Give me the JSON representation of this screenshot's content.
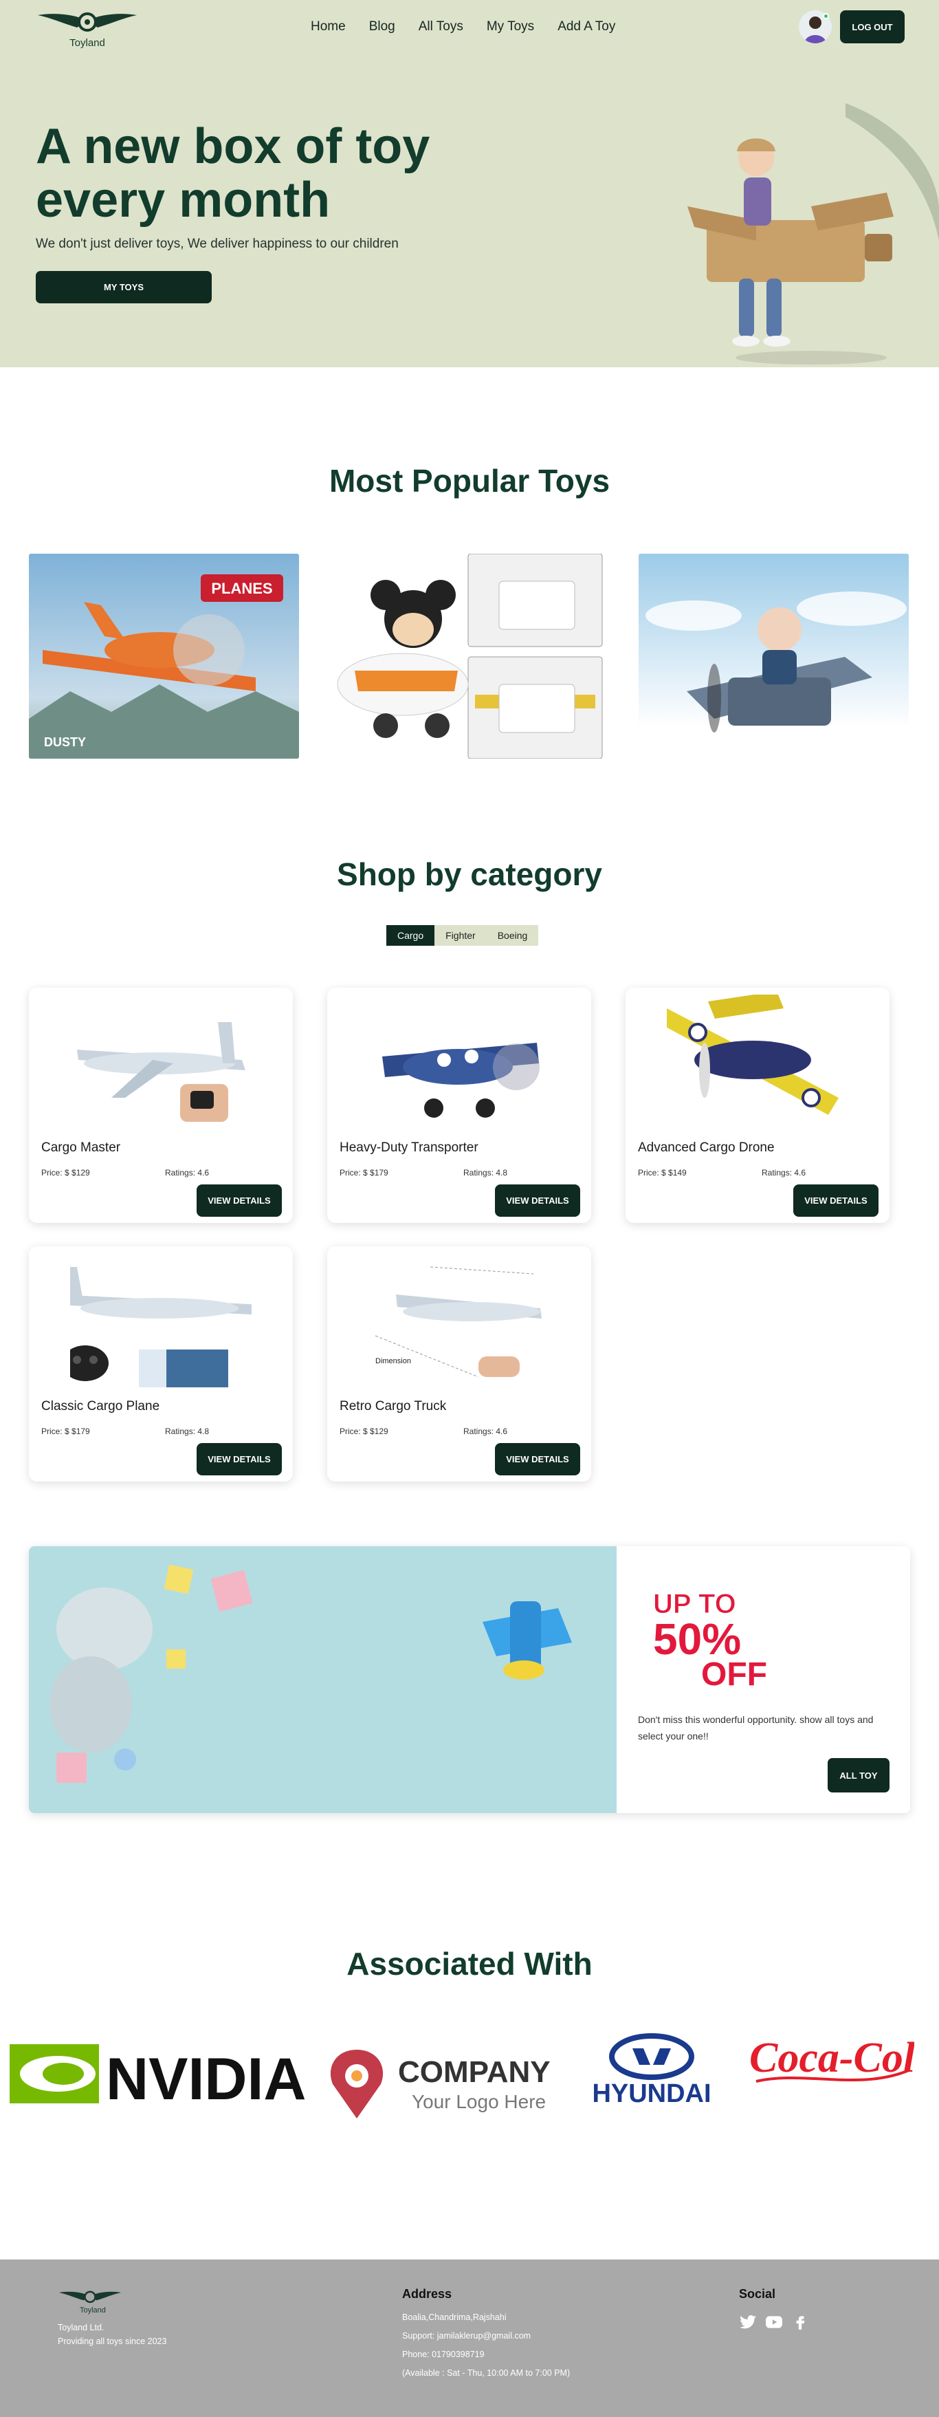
{
  "brand": {
    "name": "Toyland"
  },
  "nav": {
    "links": [
      "Home",
      "Blog",
      "All Toys",
      "My Toys",
      "Add A Toy"
    ],
    "logout": "LOG OUT"
  },
  "hero": {
    "title": "A new box of toy every month",
    "subtitle": "We don't just deliver toys, We deliver happiness to our children",
    "button": "MY TOYS"
  },
  "popular": {
    "title": "Most Popular Toys",
    "items": [
      {
        "caption": "DUSTY",
        "logo": "PLANES"
      },
      {
        "caption": ""
      },
      {
        "caption": ""
      }
    ]
  },
  "category": {
    "title": "Shop by category",
    "tabs": [
      "Cargo",
      "Fighter",
      "Boeing"
    ],
    "active_tab": "Cargo",
    "cards": [
      {
        "name": "Cargo Master",
        "price": "Price: $ $129",
        "rating": "Ratings: 4.6",
        "button": "VIEW DETAILS"
      },
      {
        "name": "Heavy-Duty Transporter",
        "price": "Price: $ $179",
        "rating": "Ratings: 4.8",
        "button": "VIEW DETAILS"
      },
      {
        "name": "Advanced Cargo Drone",
        "price": "Price: $ $149",
        "rating": "Ratings: 4.6",
        "button": "VIEW DETAILS"
      },
      {
        "name": "Classic Cargo Plane",
        "price": "Price: $ $179",
        "rating": "Ratings: 4.8",
        "button": "VIEW DETAILS"
      },
      {
        "name": "Retro Cargo Truck",
        "price": "Price: $ $129",
        "rating": "Ratings: 4.6",
        "button": "VIEW DETAILS"
      }
    ],
    "dimension_label": "Dimension"
  },
  "promo": {
    "badge_top": "UP TO",
    "badge_percent": "50%",
    "badge_off": "OFF",
    "text": "Don't miss this wonderful opportunity. show all toys and select your one!!",
    "button": "ALL TOY"
  },
  "associated": {
    "title": "Associated With",
    "logos": [
      "NVIDIA",
      "COMPANY",
      "Your Logo Here",
      "HYUNDAI",
      "Coca-Cola"
    ]
  },
  "footer": {
    "brand": "Toyland",
    "company": "Toyland Ltd.",
    "tagline": "Providing all toys since 2023",
    "address_title": "Address",
    "address": "Boalia,Chandrima,Rajshahi",
    "support": "Support: jamilaklerup@gmail.com",
    "phone": "Phone: 01790398719",
    "hours": "(Available : Sat - Thu, 10:00 AM to 7:00 PM)",
    "social_title": "Social",
    "social": [
      "twitter-icon",
      "youtube-icon",
      "facebook-icon"
    ]
  },
  "colors": {
    "accent": "#0f2a20",
    "hero_bg": "#dde2cb",
    "title": "#123c2c",
    "footer_bg": "#a9a9a9"
  }
}
